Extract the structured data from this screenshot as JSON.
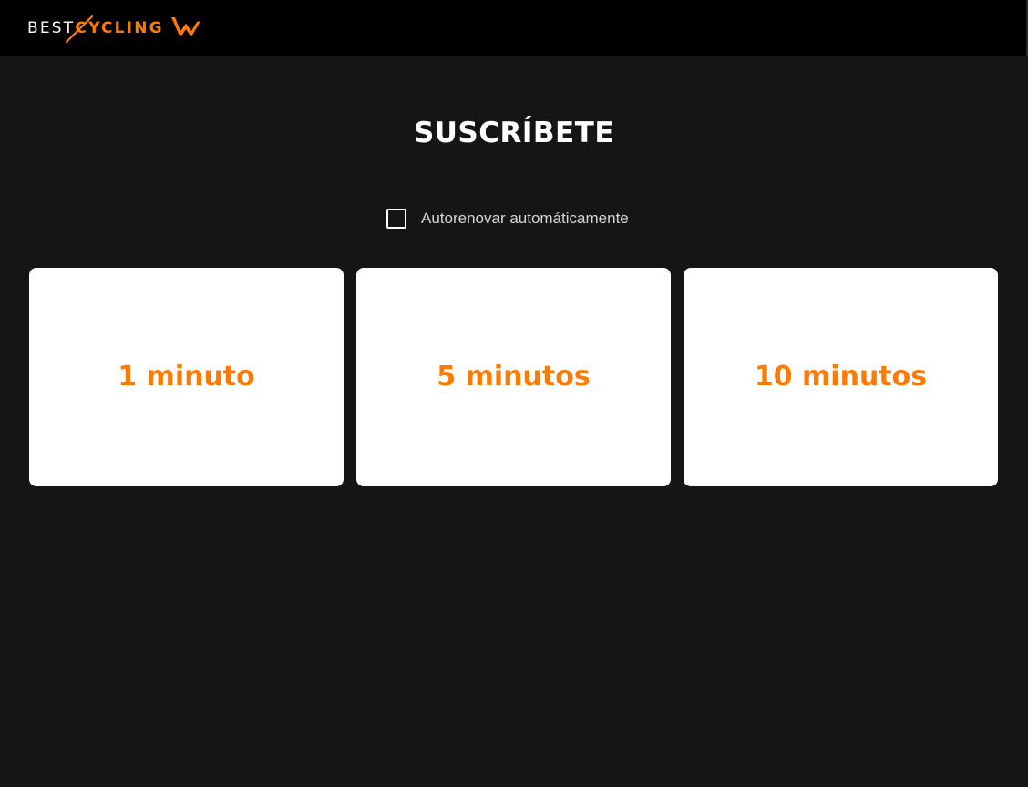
{
  "header": {
    "logo_primary": "BEST",
    "logo_secondary": "CYCLING",
    "brand_color": "#ff7a00",
    "logo_mark_icon": "bestcycling-wings-icon"
  },
  "page": {
    "title": "SUSCRÍBETE"
  },
  "renewal": {
    "label": "Autorenovar automáticamente",
    "checked": false
  },
  "plans": [
    {
      "label": "1 minuto"
    },
    {
      "label": "5 minutos"
    },
    {
      "label": "10 minutos"
    }
  ],
  "colors": {
    "background": "#151515",
    "header_background": "#000000",
    "card_background": "#ffffff",
    "accent": "#ff7a00"
  }
}
